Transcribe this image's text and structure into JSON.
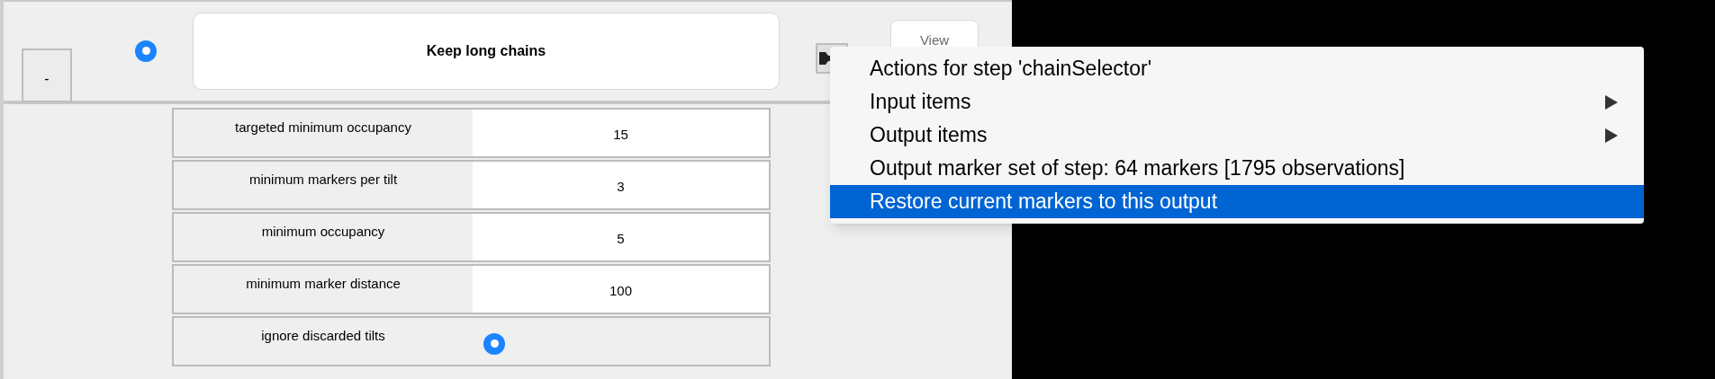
{
  "step": {
    "collapse_button": "-",
    "selected": true,
    "name": "Keep long chains",
    "view_button": "View"
  },
  "parameters": [
    {
      "kind": "number",
      "label": "targeted minimum occupancy",
      "value": "15"
    },
    {
      "kind": "number",
      "label": "minimum markers per tilt",
      "value": "3"
    },
    {
      "kind": "number",
      "label": "minimum occupancy",
      "value": "5"
    },
    {
      "kind": "number",
      "label": "minimum marker distance",
      "value": "100"
    },
    {
      "kind": "toggle",
      "label": "ignore discarded tilts",
      "selected": true
    }
  ],
  "context_menu": {
    "items": [
      {
        "label": "Actions for step 'chainSelector'",
        "has_submenu": false,
        "selected": false
      },
      {
        "label": "Input items",
        "has_submenu": true,
        "selected": false
      },
      {
        "label": "Output items",
        "has_submenu": true,
        "selected": false
      },
      {
        "label": "Output marker set of step: 64 markers [1795 observations]",
        "has_submenu": false,
        "selected": false
      },
      {
        "label": "Restore current markers to this output",
        "has_submenu": false,
        "selected": true
      }
    ]
  }
}
